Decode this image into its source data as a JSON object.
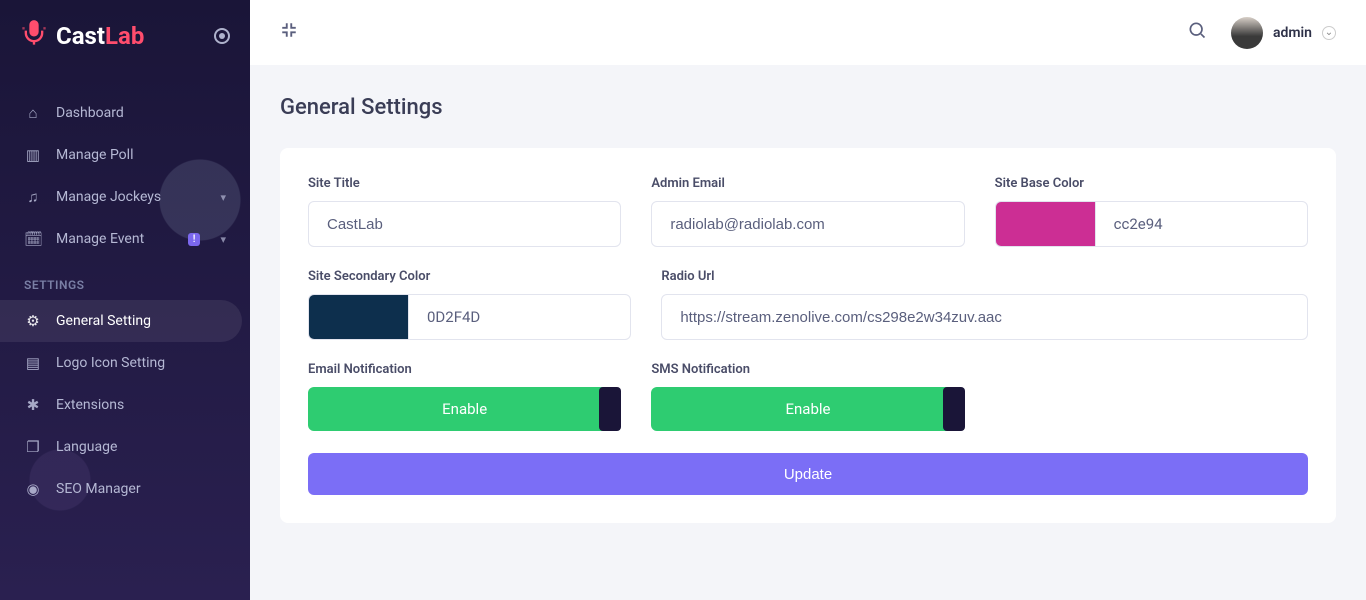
{
  "app": {
    "name_left": "Cast",
    "name_right": "Lab"
  },
  "sidebar": {
    "items": [
      {
        "label": "Dashboard",
        "icon": "⌂"
      },
      {
        "label": "Manage Poll",
        "icon": "▥"
      },
      {
        "label": "Manage Jockeys",
        "icon": "♫"
      },
      {
        "label": "Manage Event",
        "icon": "🗓",
        "badge": "!"
      }
    ],
    "settings_header": "SETTINGS",
    "settings": [
      {
        "label": "General Setting",
        "icon": "⚙"
      },
      {
        "label": "Logo Icon Setting",
        "icon": "▤"
      },
      {
        "label": "Extensions",
        "icon": "✱"
      },
      {
        "label": "Language",
        "icon": "❐"
      },
      {
        "label": "SEO Manager",
        "icon": "◉"
      }
    ]
  },
  "topbar": {
    "user": "admin"
  },
  "page": {
    "title": "General Settings"
  },
  "form": {
    "site_title_label": "Site Title",
    "site_title_value": "CastLab",
    "admin_email_label": "Admin Email",
    "admin_email_value": "radiolab@radiolab.com",
    "base_color_label": "Site Base Color",
    "base_color_value": "cc2e94",
    "base_color_hex": "#cc2e94",
    "secondary_color_label": "Site Secondary Color",
    "secondary_color_value": "0D2F4D",
    "secondary_color_hex": "#0D2F4D",
    "radio_url_label": "Radio Url",
    "radio_url_value": "https://stream.zenolive.com/cs298e2w34zuv.aac",
    "email_notif_label": "Email Notification",
    "email_notif_state": "Enable",
    "sms_notif_label": "SMS Notification",
    "sms_notif_state": "Enable",
    "update_label": "Update"
  }
}
